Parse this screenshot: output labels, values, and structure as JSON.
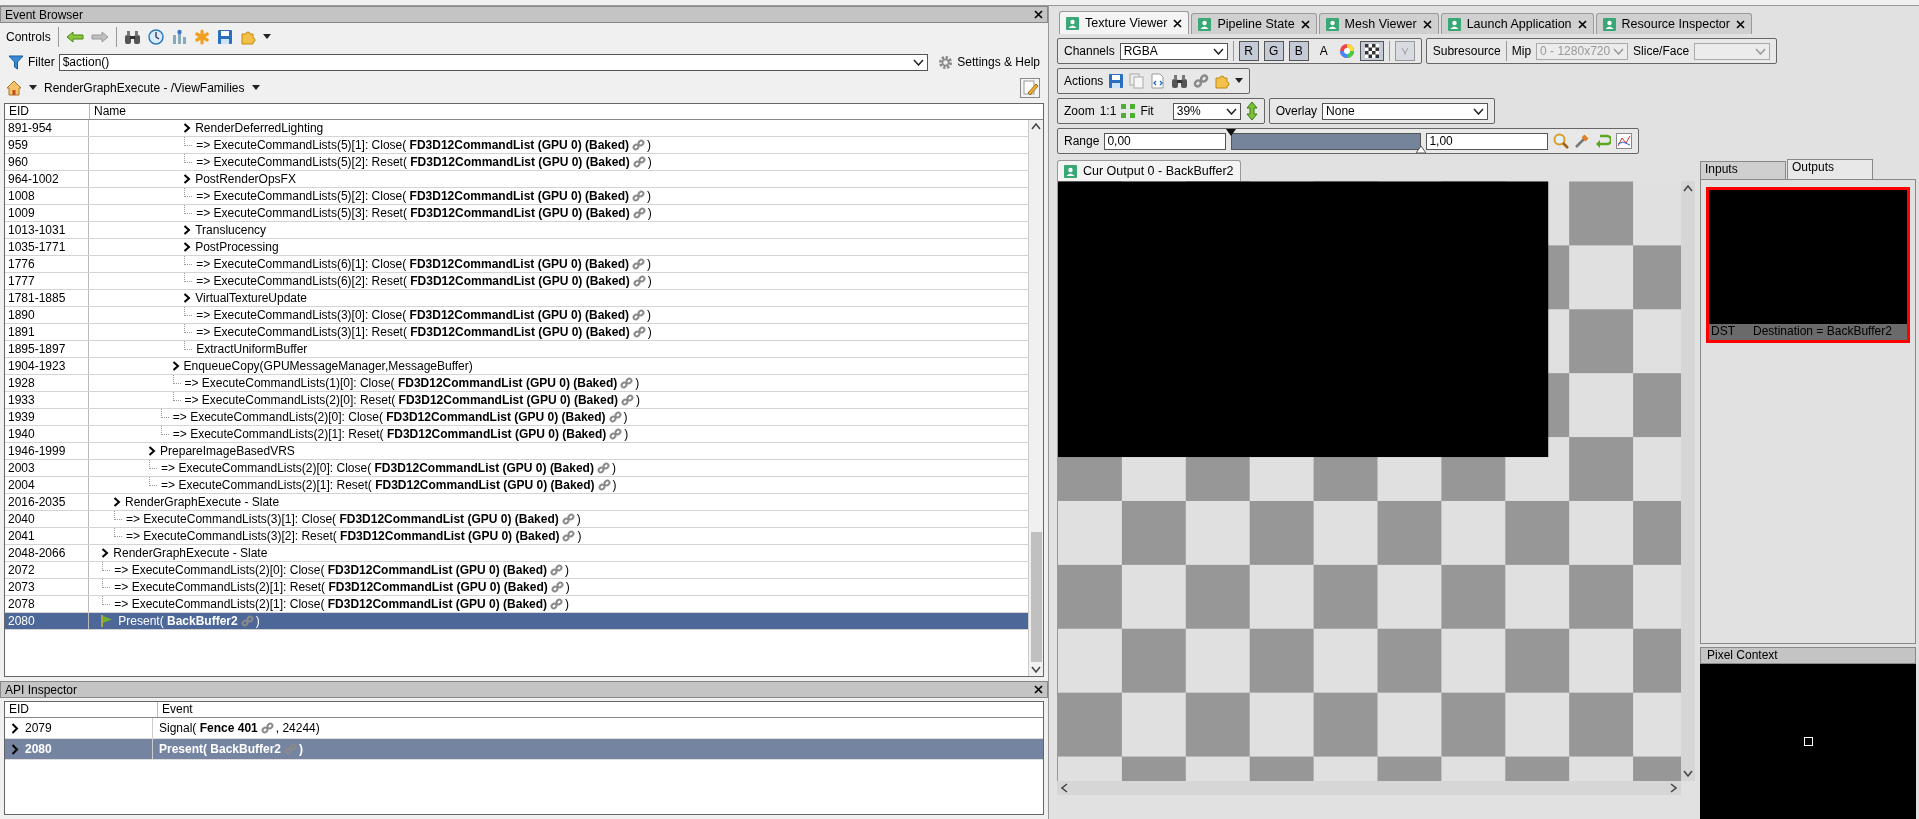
{
  "event_browser": {
    "title": "Event Browser",
    "controls_label": "Controls",
    "filter": {
      "label": "Filter",
      "value": "$action()"
    },
    "settings_label": "Settings & Help",
    "breadcrumb": "RenderGraphExecute - /ViewFamilies",
    "columns": [
      "EID",
      "Name"
    ],
    "events": [
      {
        "children": [
          {
            "children": [
              {
                "children": [
                  {
                    "children": [
                      {
                        "children": [
                          {
                            "children": [
                              {
                                "children": [
                                  {
                                    "eid": "891-954",
                                    "kind": "group",
                                    "name": "RenderDeferredLighting",
                                    "selected": false
                                  },
                                  {
                                    "eid": "959",
                                    "kind": "call",
                                    "name": "=> ExecuteCommandLists(5)[1]: Close( **FD3D12CommandList (GPU 0) (Baked)**",
                                    "after": ")",
                                    "selected": false
                                  },
                                  {
                                    "eid": "960",
                                    "kind": "call",
                                    "name": "=> ExecuteCommandLists(5)[2]: Reset( **FD3D12CommandList (GPU 0) (Baked)**",
                                    "after": ")",
                                    "selected": false
                                  },
                                  {
                                    "eid": "964-1002",
                                    "kind": "group",
                                    "name": "PostRenderOpsFX",
                                    "selected": false
                                  },
                                  {
                                    "eid": "1008",
                                    "kind": "call",
                                    "name": "=> ExecuteCommandLists(5)[2]: Close( **FD3D12CommandList (GPU 0) (Baked)**",
                                    "after": ")",
                                    "selected": false
                                  },
                                  {
                                    "eid": "1009",
                                    "kind": "call",
                                    "name": "=> ExecuteCommandLists(5)[3]: Reset( **FD3D12CommandList (GPU 0) (Baked)**",
                                    "after": ")",
                                    "selected": false
                                  },
                                  {
                                    "eid": "1013-1031",
                                    "kind": "group",
                                    "name": "Translucency",
                                    "selected": false
                                  },
                                  {
                                    "eid": "1035-1771",
                                    "kind": "group",
                                    "name": "PostProcessing",
                                    "selected": false
                                  },
                                  {
                                    "eid": "1776",
                                    "kind": "call",
                                    "name": "=> ExecuteCommandLists(6)[1]: Close( **FD3D12CommandList (GPU 0) (Baked)**",
                                    "after": ")",
                                    "selected": false
                                  },
                                  {
                                    "eid": "1777",
                                    "kind": "call",
                                    "name": "=> ExecuteCommandLists(6)[2]: Reset( **FD3D12CommandList (GPU 0) (Baked)**",
                                    "after": ")",
                                    "selected": false
                                  },
                                  {
                                    "eid": "1781-1885",
                                    "kind": "group",
                                    "name": "VirtualTextureUpdate",
                                    "selected": false
                                  },
                                  {
                                    "eid": "1890",
                                    "kind": "call",
                                    "name": "=> ExecuteCommandLists(3)[0]: Close( **FD3D12CommandList (GPU 0) (Baked)**",
                                    "after": ")",
                                    "selected": false
                                  },
                                  {
                                    "eid": "1891",
                                    "kind": "call",
                                    "name": "=> ExecuteCommandLists(3)[1]: Reset( **FD3D12CommandList (GPU 0) (Baked)**",
                                    "after": ")",
                                    "selected": false
                                  },
                                  {
                                    "eid": "1895-1897",
                                    "kind": "leaf",
                                    "name": "ExtractUniformBuffer",
                                    "selected": false
                                  }
                                ]
                              },
                              {
                                "eid": "1904-1923",
                                "kind": "group",
                                "name": "EnqueueCopy(GPUMessageManager,MessageBuffer)",
                                "selected": false
                              },
                              {
                                "eid": "1928",
                                "kind": "call",
                                "name": "=> ExecuteCommandLists(1)[0]: Close( **FD3D12CommandList (GPU 0) (Baked)**",
                                "after": ")",
                                "selected": false
                              },
                              {
                                "eid": "1933",
                                "kind": "call",
                                "name": "=> ExecuteCommandLists(2)[0]: Reset( **FD3D12CommandList (GPU 0) (Baked)**",
                                "after": ")",
                                "selected": false
                              }
                            ]
                          },
                          {
                            "eid": "1939",
                            "kind": "call",
                            "name": "=> ExecuteCommandLists(2)[0]: Close( **FD3D12CommandList (GPU 0) (Baked)**",
                            "after": ")",
                            "selected": false
                          },
                          {
                            "eid": "1940",
                            "kind": "call",
                            "name": "=> ExecuteCommandLists(2)[1]: Reset( **FD3D12CommandList (GPU 0) (Baked)**",
                            "after": ")",
                            "selected": false
                          }
                        ]
                      },
                      {
                        "eid": "1946-1999",
                        "kind": "group",
                        "name": "PrepareImageBasedVRS",
                        "selected": false
                      },
                      {
                        "eid": "2003",
                        "kind": "call",
                        "name": "=> ExecuteCommandLists(2)[0]: Close( **FD3D12CommandList (GPU 0) (Baked)**",
                        "after": ")",
                        "selected": false
                      },
                      {
                        "eid": "2004",
                        "kind": "call",
                        "name": "=> ExecuteCommandLists(2)[1]: Reset( **FD3D12CommandList (GPU 0) (Baked)**",
                        "after": ")",
                        "selected": false
                      }
                    ]
                  }
                ]
              }
            ]
          },
          {
            "eid": "2016-2035",
            "kind": "group",
            "name": "RenderGraphExecute - Slate",
            "selected": false
          },
          {
            "eid": "2040",
            "kind": "call",
            "name": "=> ExecuteCommandLists(3)[1]: Close( **FD3D12CommandList (GPU 0) (Baked)**",
            "after": ")",
            "selected": false
          },
          {
            "eid": "2041",
            "kind": "call",
            "name": "=> ExecuteCommandLists(3)[2]: Reset( **FD3D12CommandList (GPU 0) (Baked)**",
            "after": ")",
            "selected": false
          }
        ]
      },
      {
        "eid": "2048-2066",
        "kind": "group",
        "name": "RenderGraphExecute - Slate",
        "selected": false
      },
      {
        "eid": "2072",
        "kind": "call",
        "name": "=> ExecuteCommandLists(2)[0]: Close( **FD3D12CommandList (GPU 0) (Baked)**",
        "after": ")",
        "selected": false
      },
      {
        "eid": "2073",
        "kind": "call",
        "name": "=> ExecuteCommandLists(2)[1]: Reset( **FD3D12CommandList (GPU 0) (Baked)**",
        "after": ")",
        "selected": false
      },
      {
        "eid": "2078",
        "kind": "call",
        "name": "=> ExecuteCommandLists(2)[1]: Close( **FD3D12CommandList (GPU 0) (Baked)**",
        "after": ")",
        "selected": false
      },
      {
        "eid": "2080",
        "kind": "marker",
        "name": "Present( **BackBuffer2**",
        "after": ")",
        "selected": true
      }
    ]
  },
  "api_inspector": {
    "title": "API Inspector",
    "columns": [
      "EID",
      "Event"
    ],
    "rows": [
      {
        "eid": "2079",
        "call": "Signal( **Fence 401**",
        "after": ", 24244)",
        "selected": false
      },
      {
        "eid": "2080",
        "call": "Present( BackBuffer2",
        "after": ")",
        "selected": true
      }
    ]
  },
  "texture_viewer": {
    "tabs": [
      {
        "label": "Texture Viewer",
        "selected": true
      },
      {
        "label": "Pipeline State",
        "selected": false
      },
      {
        "label": "Mesh Viewer",
        "selected": false
      },
      {
        "label": "Launch Application",
        "selected": false
      },
      {
        "label": "Resource Inspector",
        "selected": false
      }
    ],
    "channels": {
      "label": "Channels",
      "value": "RGBA",
      "toggles": [
        {
          "label": "R",
          "on": true
        },
        {
          "label": "G",
          "on": true
        },
        {
          "label": "B",
          "on": true
        },
        {
          "label": "A",
          "on": false
        }
      ],
      "checker_on": true
    },
    "subresource_label": "Subresource",
    "mip": {
      "label": "Mip",
      "value": "0 - 1280x720",
      "disabled": true
    },
    "slice": {
      "label": "Slice/Face",
      "disabled": true
    },
    "actions_label": "Actions",
    "zoom": {
      "label": "Zoom",
      "one_to_one": "1:1",
      "fit": "Fit",
      "value": "39%"
    },
    "overlay": {
      "label": "Overlay",
      "value": "None"
    },
    "range": {
      "label": "Range",
      "min": "0,00",
      "max": "1,00"
    },
    "output_tab": "Cur Output 0 - BackBuffer2",
    "side_tabs": [
      {
        "label": "Inputs",
        "selected": false
      },
      {
        "label": "Outputs",
        "selected": true
      }
    ],
    "thumbnail": {
      "tag": "DST",
      "caption": "Destination = BackBuffer2"
    },
    "pixel_context": "Pixel Context"
  }
}
